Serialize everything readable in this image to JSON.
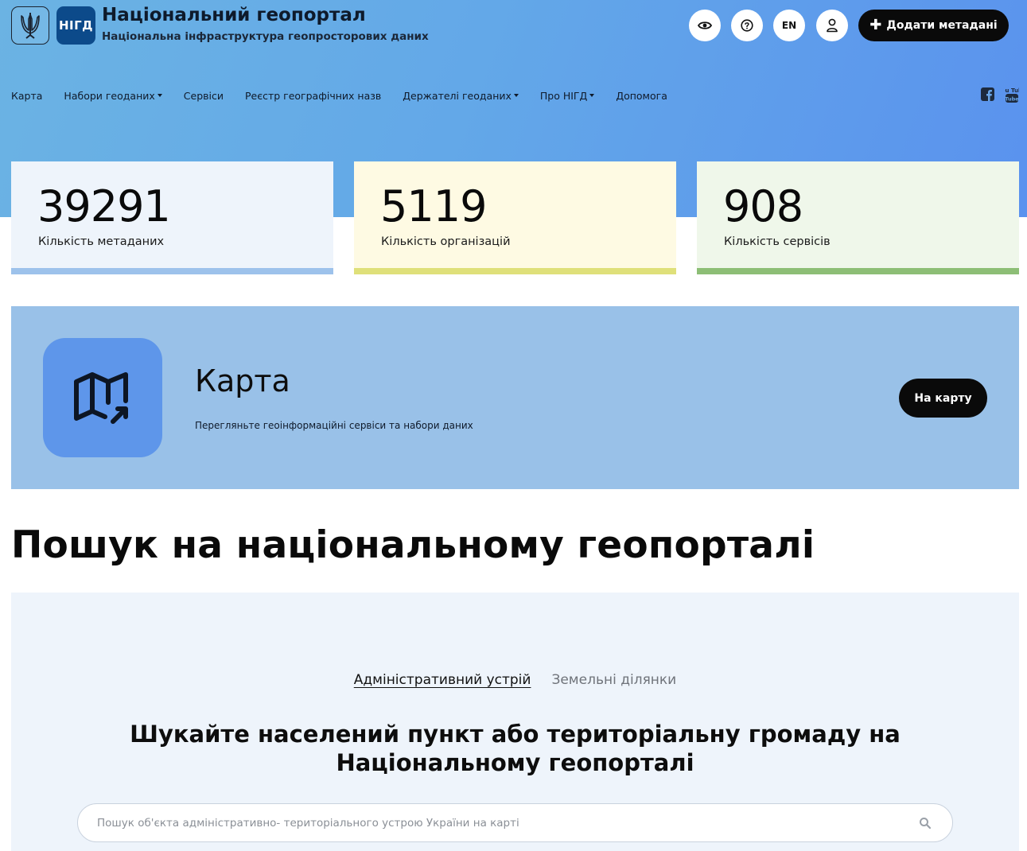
{
  "header": {
    "logo_text": "НІГД",
    "title": "Національний геопортал",
    "subtitle": "Національна інфраструктура геопросторових даних",
    "lang_label": "EN",
    "add_metadata_label": "Додати метадані",
    "icons": [
      "trident-icon",
      "eye-icon",
      "help-icon",
      "user-icon",
      "plus-icon"
    ]
  },
  "nav": {
    "items": [
      {
        "label": "Карта",
        "dropdown": false
      },
      {
        "label": "Набори геоданих",
        "dropdown": true
      },
      {
        "label": "Сервіси",
        "dropdown": false
      },
      {
        "label": "Реєстр географічних назв",
        "dropdown": false
      },
      {
        "label": "Держателі геоданих",
        "dropdown": true
      },
      {
        "label": "Про НІГД",
        "dropdown": true
      },
      {
        "label": "Допомога",
        "dropdown": false
      }
    ],
    "social": [
      "facebook-icon",
      "youtube-icon"
    ],
    "youtube_text": "You Tube"
  },
  "stats": [
    {
      "value": "39291",
      "label": "Кількість метаданих",
      "bg": "#eef4fb",
      "accent": "#9dc2eb"
    },
    {
      "value": "5119",
      "label": "Кількість організацій",
      "bg": "#fefae3",
      "accent": "#dfe07a"
    },
    {
      "value": "908",
      "label": "Кількість сервісів",
      "bg": "#eff7ea",
      "accent": "#8dbe76"
    }
  ],
  "map_banner": {
    "title": "Карта",
    "description": "Перегляньте геоінформаційні сервіси та набори даних",
    "button_label": "На карту",
    "icon": "map-arrow-icon"
  },
  "search": {
    "heading": "Пошук на національному геопорталі",
    "tabs": [
      {
        "label": "Адміністративний устрій",
        "active": true
      },
      {
        "label": "Земельні ділянки",
        "active": false
      }
    ],
    "panel_heading_line1": "Шукайте населений пункт або територіальну громаду на",
    "panel_heading_line2": "Національному геопорталі",
    "placeholder": "Пошук об'єкта адміністративно- територіального устрою України на карті",
    "icon": "search-icon"
  },
  "colors": {
    "hero_gradient_start": "#6bb3e3",
    "hero_gradient_end": "#5a92ee",
    "logo_blue": "#0c4a8a",
    "banner_bg": "#99c1e8",
    "map_icon_bg": "#5e96ea",
    "dark_button": "#0a0a0a",
    "search_panel_bg": "#eef4fb"
  }
}
